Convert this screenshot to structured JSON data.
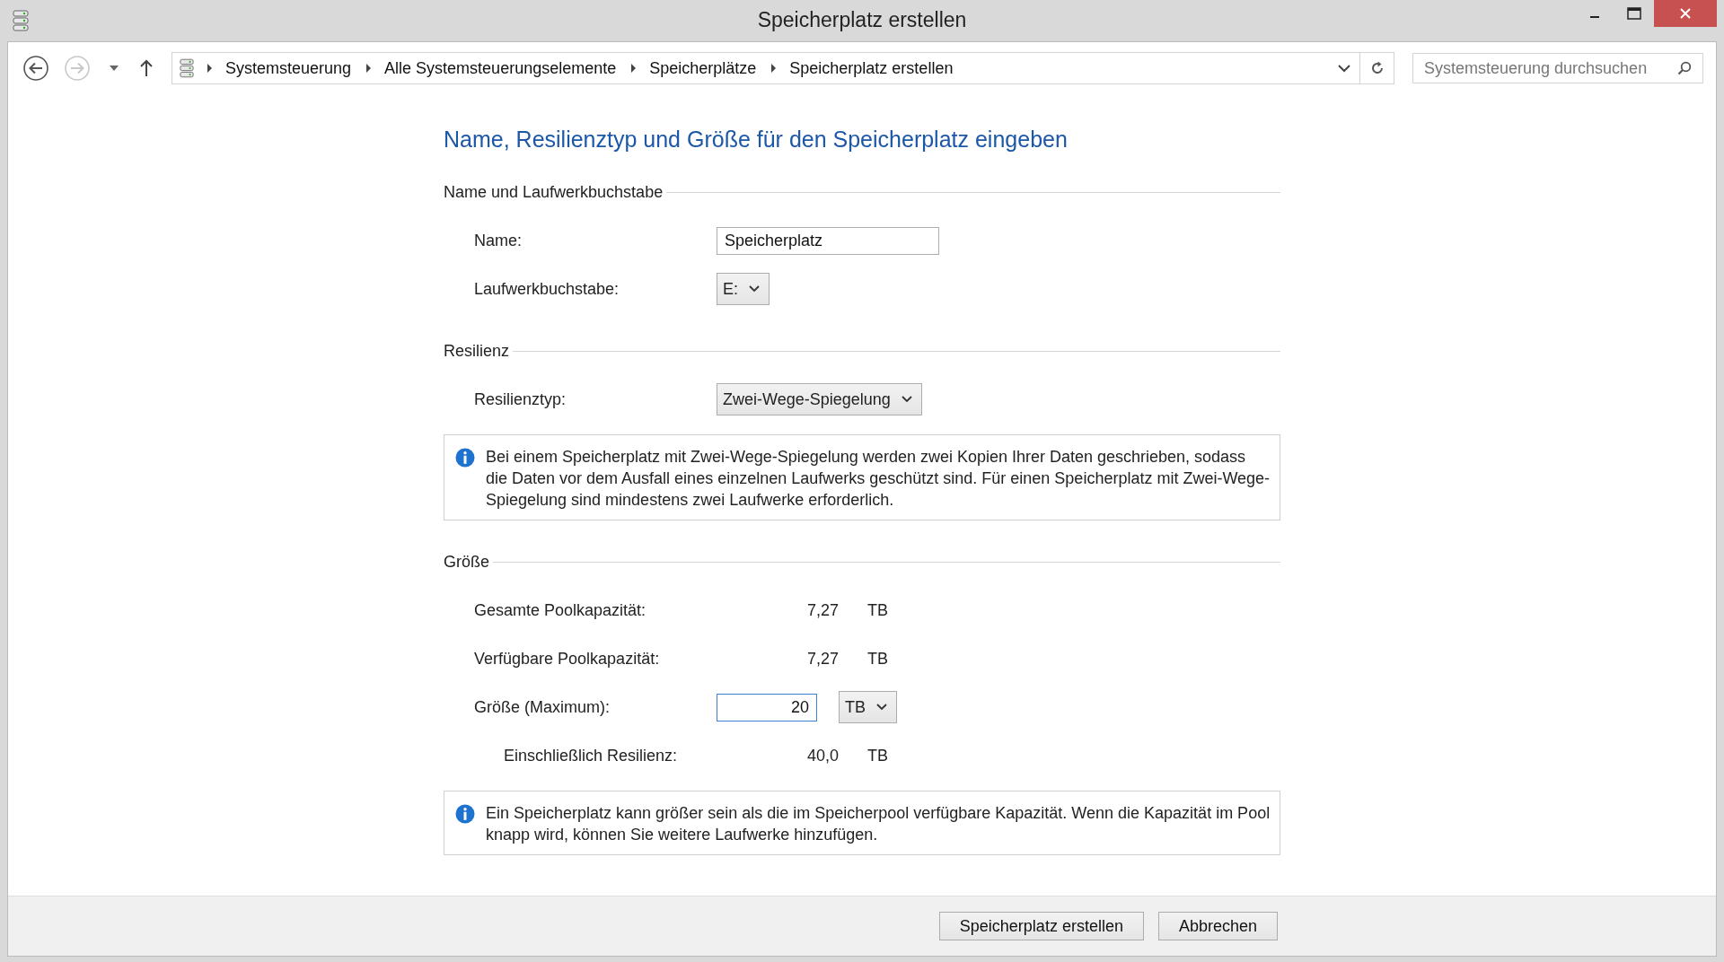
{
  "window": {
    "title": "Speicherplatz erstellen"
  },
  "address_bar": {
    "breadcrumbs": [
      "Systemsteuerung",
      "Alle Systemsteuerungselemente",
      "Speicherplätze",
      "Speicherplatz erstellen"
    ]
  },
  "search": {
    "placeholder": "Systemsteuerung durchsuchen"
  },
  "heading": "Name, Resilienztyp und Größe für den Speicherplatz eingeben",
  "sections": [
    {
      "title": "Name und Laufwerkbuchstabe",
      "rows": [
        {
          "kind": "text_input",
          "label": "Name:",
          "value": "Speicherplatz"
        },
        {
          "kind": "dropdown",
          "label": "Laufwerkbuchstabe:",
          "value": "E:"
        }
      ]
    },
    {
      "title": "Resilienz",
      "rows": [
        {
          "kind": "dropdown",
          "label": "Resilienztyp:",
          "value": "Zwei-Wege-Spiegelung"
        }
      ],
      "info": "Bei einem Speicherplatz mit Zwei-Wege-Spiegelung werden zwei Kopien Ihrer Daten geschrieben, sodass die Daten vor dem Ausfall eines einzelnen Laufwerks geschützt sind. Für einen Speicherplatz mit Zwei-Wege-Spiegelung sind mindestens zwei Laufwerke erforderlich."
    },
    {
      "title": "Größe",
      "rows": [
        {
          "kind": "reading",
          "label": "Gesamte Poolkapazität:",
          "value": "7,27",
          "unit": "TB",
          "indented": false
        },
        {
          "kind": "reading",
          "label": "Verfügbare Poolkapazität:",
          "value": "7,27",
          "unit": "TB",
          "indented": false
        },
        {
          "kind": "size_input",
          "label": "Größe (Maximum):",
          "value": "20",
          "unit": "TB"
        },
        {
          "kind": "reading",
          "label": "Einschließlich Resilienz:",
          "value": "40,0",
          "unit": "TB",
          "indented": true
        }
      ],
      "info": "Ein Speicherplatz kann größer sein als die im Speicherpool verfügbare Kapazität. Wenn die Kapazität im Pool knapp wird, können Sie weitere Laufwerke hinzufügen."
    }
  ],
  "buttons": [
    "Speicherplatz erstellen",
    "Abbrechen"
  ]
}
